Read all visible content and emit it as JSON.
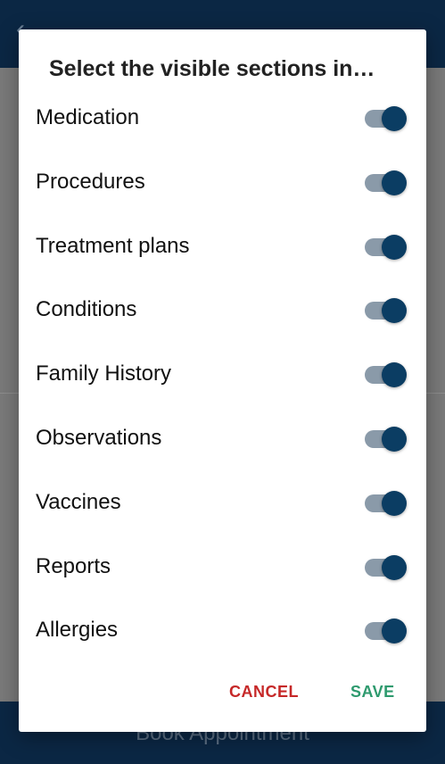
{
  "background": {
    "title": "…",
    "bottom_button": "Book Appointment"
  },
  "dialog": {
    "title": "Select the visible sections in…",
    "items": [
      {
        "label": "Medication",
        "on": true
      },
      {
        "label": "Procedures",
        "on": true
      },
      {
        "label": "Treatment plans",
        "on": true
      },
      {
        "label": "Conditions",
        "on": true
      },
      {
        "label": "Family History",
        "on": true
      },
      {
        "label": "Observations",
        "on": true
      },
      {
        "label": "Vaccines",
        "on": true
      },
      {
        "label": "Reports",
        "on": true
      },
      {
        "label": "Allergies",
        "on": true
      }
    ],
    "cancel_label": "CANCEL",
    "save_label": "SAVE"
  },
  "colors": {
    "primary": "#0b3d63",
    "appbar": "#0b2744",
    "cancel": "#c62828",
    "save": "#2e9a6e"
  }
}
